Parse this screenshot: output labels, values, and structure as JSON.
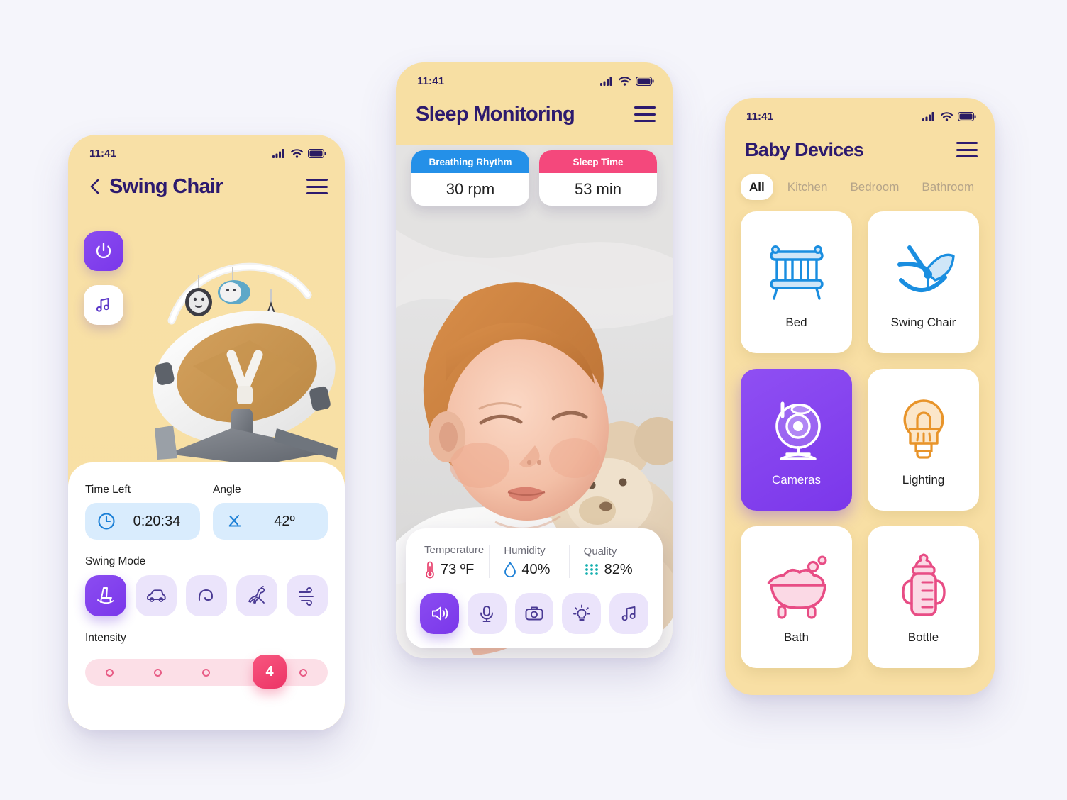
{
  "background_color": "#f5f5fb",
  "screens": [
    {
      "id": "swing-chair",
      "status": {
        "time": "11:41",
        "icons": [
          "cellular-icon",
          "wifi-icon",
          "battery-icon"
        ]
      },
      "header": {
        "title": "Swing Chair",
        "back_icon": "chevron-left-icon",
        "menu_icon": "hamburger-icon"
      },
      "side_buttons": [
        {
          "name": "power-button",
          "icon": "power-icon",
          "state": "on"
        },
        {
          "name": "music-button",
          "icon": "music-note-icon",
          "state": "off"
        }
      ],
      "hero": {
        "image_alt": "baby swing chair product"
      },
      "fields": [
        {
          "label": "Time Left",
          "value": "0:20:34",
          "icon": "clock-icon"
        },
        {
          "label": "Angle",
          "value": "42º",
          "icon": "angle-icon"
        }
      ],
      "swing_mode": {
        "label": "Swing Mode",
        "options": [
          {
            "name": "rocking-chair",
            "icon": "rocking-chair-icon",
            "selected": true
          },
          {
            "name": "car-ride",
            "icon": "car-icon",
            "selected": false
          },
          {
            "name": "wave",
            "icon": "wave-icon",
            "selected": false
          },
          {
            "name": "kangaroo",
            "icon": "kangaroo-icon",
            "selected": false
          },
          {
            "name": "breeze",
            "icon": "wind-icon",
            "selected": false
          }
        ]
      },
      "intensity": {
        "label": "Intensity",
        "value": "4",
        "steps": 5,
        "current": 4,
        "accent": "#ec3466"
      }
    },
    {
      "id": "sleep-monitoring",
      "status": {
        "time": "11:41",
        "icons": [
          "cellular-icon",
          "wifi-icon",
          "battery-icon"
        ]
      },
      "header": {
        "title": "Sleep Monitoring",
        "menu_icon": "hamburger-icon"
      },
      "chips": [
        {
          "title": "Breathing Rhythm",
          "value": "30 rpm",
          "color": "#2490e8"
        },
        {
          "title": "Sleep Time",
          "value": "53 min",
          "color": "#f4487c"
        }
      ],
      "photo": {
        "alt": "sleeping baby with teddy bear"
      },
      "metrics": [
        {
          "name": "Temperature",
          "value": "73 ºF",
          "icon": "thermometer-icon",
          "color": "#e8436f"
        },
        {
          "name": "Humidity",
          "value": "40%",
          "icon": "water-drop-icon",
          "color": "#1b7fd6"
        },
        {
          "name": "Quality",
          "value": "82%",
          "icon": "air-quality-dots-icon",
          "color": "#17b0b0"
        }
      ],
      "actions": [
        {
          "name": "speaker",
          "icon": "speaker-icon",
          "selected": true
        },
        {
          "name": "microphone",
          "icon": "microphone-icon",
          "selected": false
        },
        {
          "name": "camera",
          "icon": "camera-icon",
          "selected": false
        },
        {
          "name": "light",
          "icon": "lightbulb-icon",
          "selected": false
        },
        {
          "name": "music",
          "icon": "music-note-icon",
          "selected": false
        }
      ]
    },
    {
      "id": "baby-devices",
      "status": {
        "time": "11:41",
        "icons": [
          "cellular-icon",
          "wifi-icon",
          "battery-icon"
        ]
      },
      "header": {
        "title": "Baby Devices",
        "menu_icon": "hamburger-icon"
      },
      "tabs": [
        {
          "label": "All",
          "active": true
        },
        {
          "label": "Kitchen",
          "active": false
        },
        {
          "label": "Bedroom",
          "active": false
        },
        {
          "label": "Bathroom",
          "active": false
        }
      ],
      "devices": [
        {
          "label": "Bed",
          "icon": "crib-icon",
          "active": false,
          "color": "#1a8ee0"
        },
        {
          "label": "Swing Chair",
          "icon": "swing-chair-icon",
          "active": false,
          "color": "#1a8ee0"
        },
        {
          "label": "Cameras",
          "icon": "webcam-icon",
          "active": true,
          "color": "#ffffff"
        },
        {
          "label": "Lighting",
          "icon": "lightbulb-icon",
          "active": false,
          "color": "#e8942a"
        },
        {
          "label": "Bath",
          "icon": "bathtub-icon",
          "active": false,
          "color": "#e84d85"
        },
        {
          "label": "Bottle",
          "icon": "baby-bottle-icon",
          "active": false,
          "color": "#e84d85"
        }
      ]
    }
  ]
}
